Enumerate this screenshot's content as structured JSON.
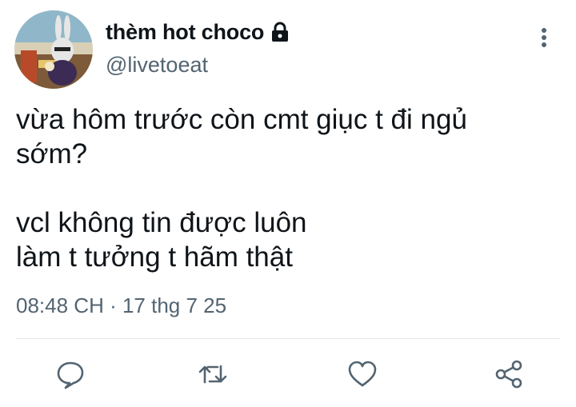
{
  "author": {
    "display_name": "thèm hot choco",
    "handle": "@livetoeat",
    "avatar_icon": "cartoon-rabbit-avatar",
    "protected_icon": "lock-icon"
  },
  "tweet": {
    "lines": [
      "vừa hôm trước còn cmt giục t đi ngủ",
      "sớm?",
      "",
      "vcl không tin được luôn",
      "làm t tưởng t hãm thật"
    ],
    "timestamp": "08:48 CH · 17 thg 7 25"
  },
  "actions": [
    {
      "name": "reply",
      "icon": "reply-icon"
    },
    {
      "name": "retweet",
      "icon": "retweet-icon"
    },
    {
      "name": "like",
      "icon": "heart-icon"
    },
    {
      "name": "share",
      "icon": "share-icon"
    }
  ],
  "colors": {
    "text": "#0f1419",
    "secondary": "#536471",
    "divider": "#e1e8ed"
  }
}
